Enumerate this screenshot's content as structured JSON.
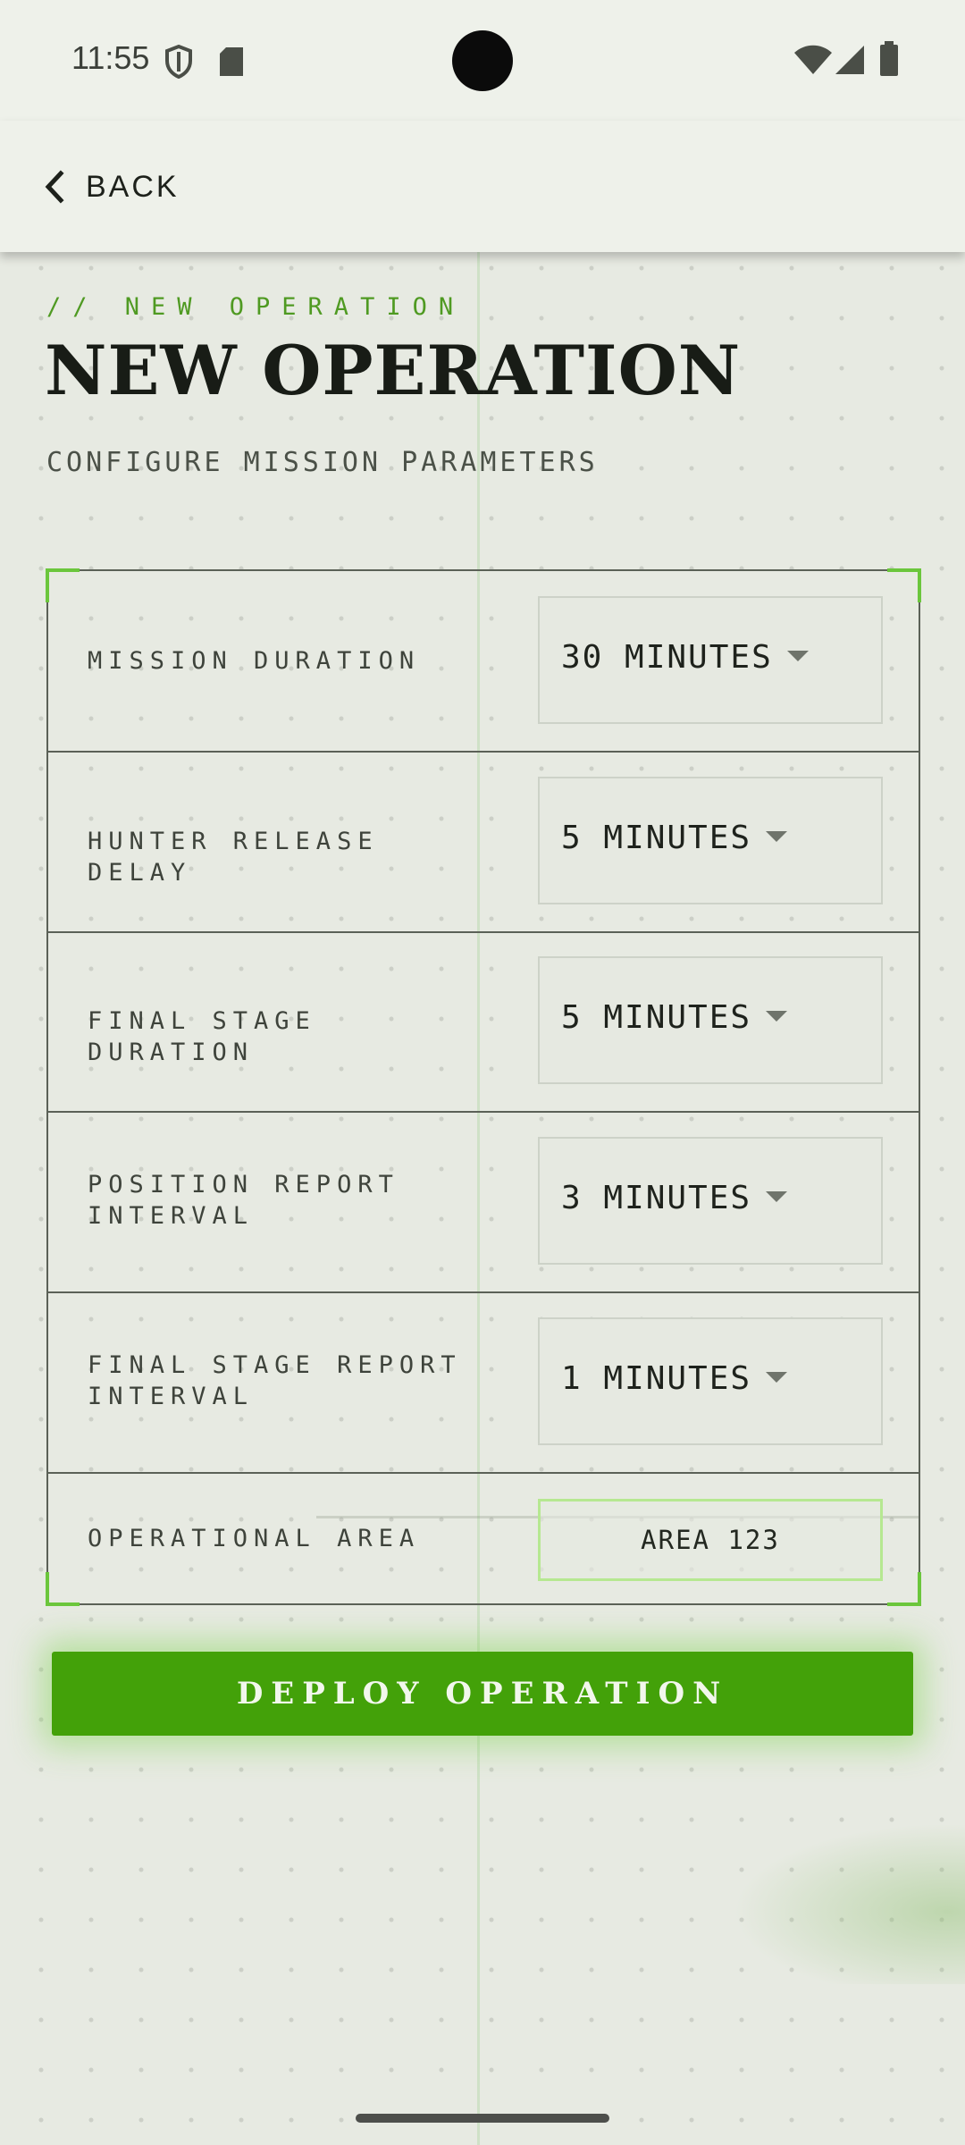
{
  "status_bar": {
    "time": "11:55",
    "left_icons": [
      "shield-icon",
      "sd-card-icon"
    ],
    "right_icons": [
      "wifi-icon",
      "cellular-icon",
      "battery-icon"
    ]
  },
  "app_bar": {
    "back_label": "BACK",
    "back_icon": "chevron-left-icon"
  },
  "header": {
    "eyebrow": "// NEW OPERATION",
    "title": "NEW OPERATION",
    "subtitle": "CONFIGURE MISSION PARAMETERS"
  },
  "settings": {
    "rows": [
      {
        "label": "MISSION DURATION",
        "value": "30 MINUTES"
      },
      {
        "label": "HUNTER RELEASE DELAY",
        "value": "5 MINUTES"
      },
      {
        "label": "FINAL STAGE DURATION",
        "value": "5 MINUTES"
      },
      {
        "label": "POSITION REPORT INTERVAL",
        "value": "3 MINUTES"
      },
      {
        "label": "FINAL STAGE REPORT INTERVAL",
        "value": "1 MINUTES"
      }
    ],
    "area": {
      "label": "OPERATIONAL AREA",
      "value": "AREA 123"
    }
  },
  "deploy_label": "DEPLOY OPERATION",
  "colors": {
    "accent": "#43a109",
    "accent_light": "#6bc63c",
    "background": "#e7eae2",
    "text": "#1e221c"
  }
}
